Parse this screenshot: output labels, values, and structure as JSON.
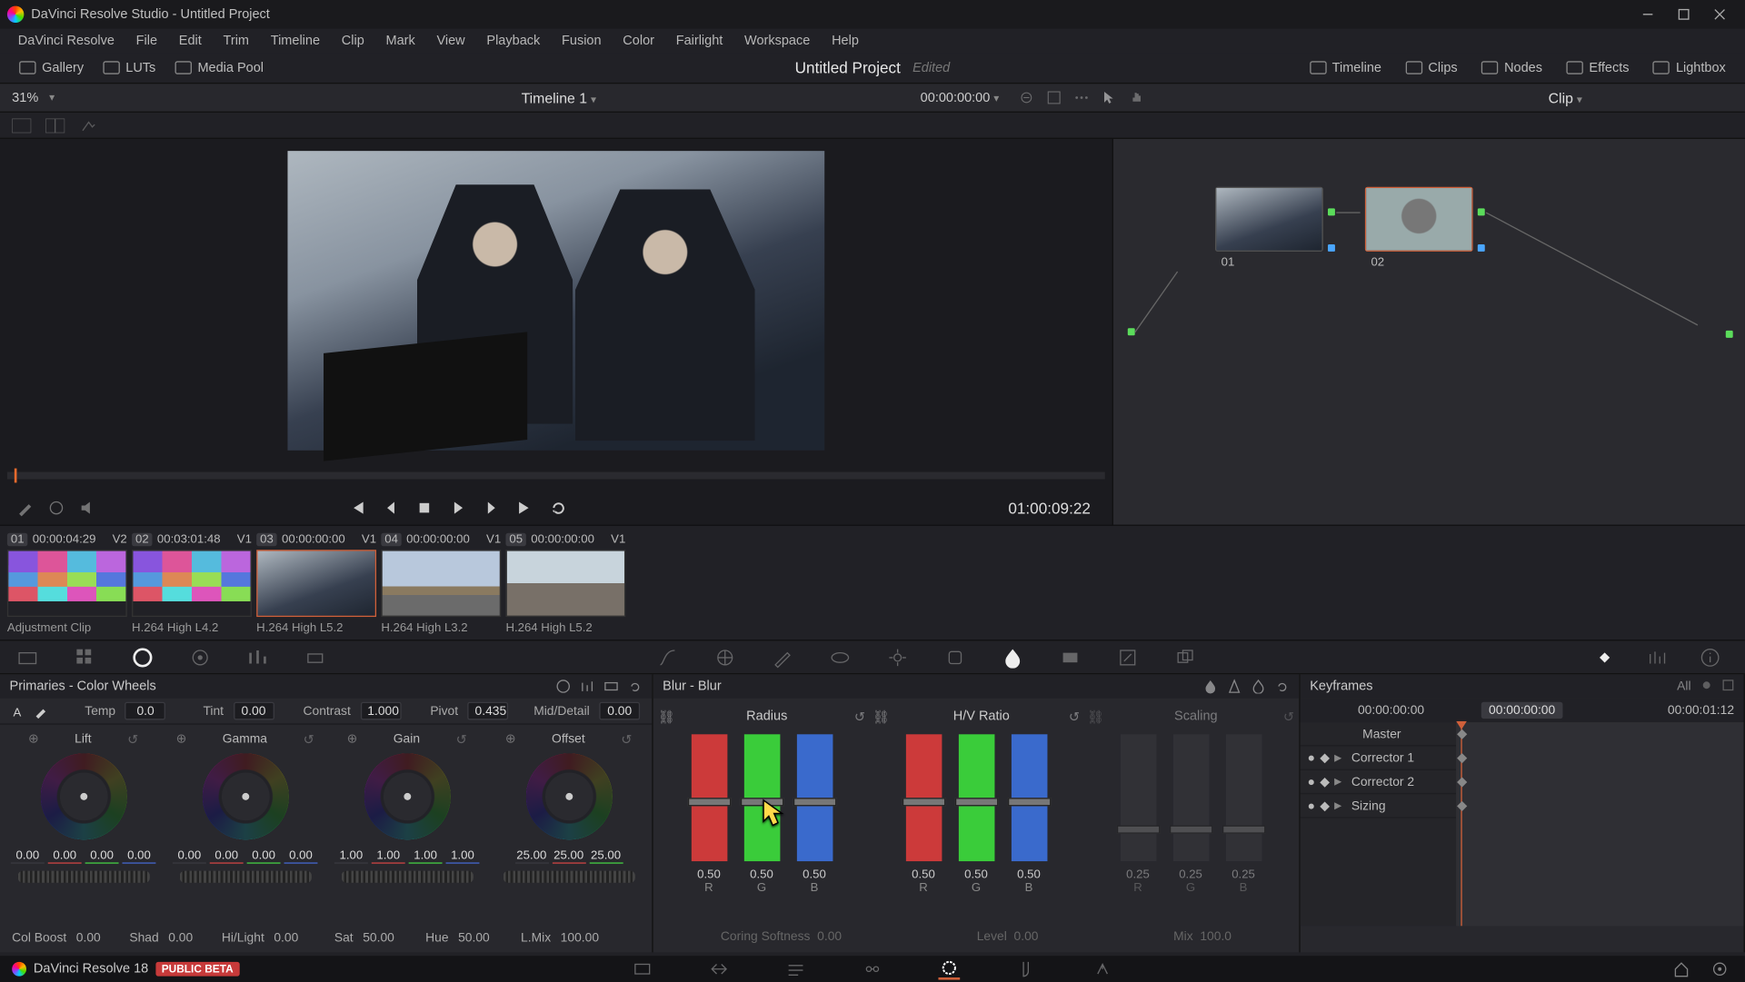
{
  "window": {
    "title": "DaVinci Resolve Studio - Untitled Project"
  },
  "menu": [
    "DaVinci Resolve",
    "File",
    "Edit",
    "Trim",
    "Timeline",
    "Clip",
    "Mark",
    "View",
    "Playback",
    "Fusion",
    "Color",
    "Fairlight",
    "Workspace",
    "Help"
  ],
  "toolstrip": {
    "left": [
      {
        "label": "Gallery"
      },
      {
        "label": "LUTs"
      },
      {
        "label": "Media Pool"
      }
    ],
    "project_title": "Untitled Project",
    "edited": "Edited",
    "right": [
      {
        "label": "Timeline"
      },
      {
        "label": "Clips"
      },
      {
        "label": "Nodes"
      },
      {
        "label": "Effects"
      },
      {
        "label": "Lightbox"
      }
    ]
  },
  "substrip": {
    "zoom": "31%",
    "timeline_name": "Timeline 1",
    "timecode": "00:00:00:00",
    "node_scope": "Clip"
  },
  "transport_time": "01:00:09:22",
  "clips": [
    {
      "idx": "01",
      "tc": "00:00:04:29",
      "trk": "V2",
      "label": "Adjustment Clip",
      "kind": "mosaic"
    },
    {
      "idx": "02",
      "tc": "00:03:01:48",
      "trk": "V1",
      "label": "H.264 High L4.2",
      "kind": "mosaic"
    },
    {
      "idx": "03",
      "tc": "00:00:00:00",
      "trk": "V1",
      "label": "H.264 High L5.2",
      "kind": "biz",
      "selected": true
    },
    {
      "idx": "04",
      "tc": "00:00:00:00",
      "trk": "V1",
      "label": "H.264 High L3.2",
      "kind": "road"
    },
    {
      "idx": "05",
      "tc": "00:00:00:00",
      "trk": "V1",
      "label": "H.264 High L5.2",
      "kind": "street"
    }
  ],
  "nodes": {
    "n1": "01",
    "n2": "02"
  },
  "primaries": {
    "title": "Primaries - Color Wheels",
    "top": {
      "temp_label": "Temp",
      "temp": "0.0",
      "tint_label": "Tint",
      "tint": "0.00",
      "contrast_label": "Contrast",
      "contrast": "1.000",
      "pivot_label": "Pivot",
      "pivot": "0.435",
      "md_label": "Mid/Detail",
      "md": "0.00"
    },
    "wheels": {
      "lift": {
        "title": "Lift",
        "v": [
          "0.00",
          "0.00",
          "0.00",
          "0.00"
        ]
      },
      "gamma": {
        "title": "Gamma",
        "v": [
          "0.00",
          "0.00",
          "0.00",
          "0.00"
        ]
      },
      "gain": {
        "title": "Gain",
        "v": [
          "1.00",
          "1.00",
          "1.00",
          "1.00"
        ]
      },
      "offset": {
        "title": "Offset",
        "v": [
          "25.00",
          "25.00",
          "25.00"
        ]
      }
    },
    "bottom": {
      "colboost_label": "Col Boost",
      "colboost": "0.00",
      "shad_label": "Shad",
      "shad": "0.00",
      "hl_label": "Hi/Light",
      "hl": "0.00",
      "sat_label": "Sat",
      "sat": "50.00",
      "hue_label": "Hue",
      "hue": "50.00",
      "lmix_label": "L.Mix",
      "lmix": "100.00"
    }
  },
  "blur": {
    "title": "Blur - Blur",
    "col1": {
      "name": "Radius",
      "r": "0.50",
      "g": "0.50",
      "b": "0.50"
    },
    "col2": {
      "name": "H/V Ratio",
      "r": "0.50",
      "g": "0.50",
      "b": "0.50"
    },
    "col3": {
      "name": "Scaling",
      "r": "0.25",
      "g": "0.25",
      "b": "0.25"
    },
    "bottom": {
      "coring_label": "Coring Softness",
      "coring": "0.00",
      "level_label": "Level",
      "level": "0.00",
      "mix_label": "Mix",
      "mix": "100.0"
    },
    "ch": {
      "r": "R",
      "g": "G",
      "b": "B"
    }
  },
  "keyframes": {
    "title": "Keyframes",
    "all": "All",
    "tc_start": "00:00:00:00",
    "tc_cur": "00:00:00:00",
    "tc_end": "00:00:01:12",
    "rows": [
      "Master",
      "Corrector 1",
      "Corrector 2",
      "Sizing"
    ]
  },
  "footer": {
    "brand": "DaVinci Resolve 18",
    "beta": "PUBLIC BETA"
  }
}
